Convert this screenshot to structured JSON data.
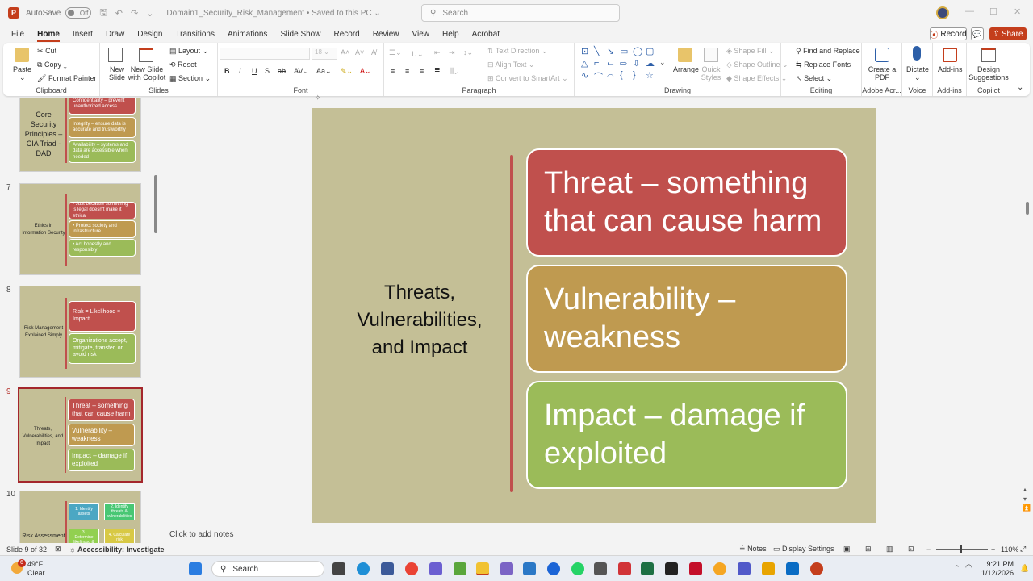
{
  "titlebar": {
    "autosave_label": "AutoSave",
    "autosave_state": "Off",
    "doc_title": "Domain1_Security_Risk_Management",
    "save_status": "Saved to this PC",
    "search_placeholder": "Search"
  },
  "menu": {
    "tabs": [
      "File",
      "Home",
      "Insert",
      "Draw",
      "Design",
      "Transitions",
      "Animations",
      "Slide Show",
      "Record",
      "Review",
      "View",
      "Help",
      "Acrobat"
    ],
    "record": "Record",
    "share": "Share"
  },
  "ribbon": {
    "clipboard": {
      "paste": "Paste",
      "cut": "Cut",
      "copy": "Copy",
      "format_painter": "Format Painter",
      "label": "Clipboard"
    },
    "slides": {
      "new_slide": "New Slide",
      "new_slide_copilot": "New Slide with Copilot",
      "layout": "Layout",
      "reset": "Reset",
      "section": "Section",
      "label": "Slides"
    },
    "font": {
      "label": "Font"
    },
    "paragraph": {
      "text_direction": "Text Direction",
      "align_text": "Align Text",
      "convert_smartart": "Convert to SmartArt",
      "label": "Paragraph"
    },
    "drawing": {
      "arrange": "Arrange",
      "quick_styles": "Quick Styles",
      "shape_fill": "Shape Fill",
      "shape_outline": "Shape Outline",
      "shape_effects": "Shape Effects",
      "label": "Drawing"
    },
    "editing": {
      "find_replace": "Find and Replace",
      "replace_fonts": "Replace Fonts",
      "select": "Select",
      "label": "Editing"
    },
    "acrobat": {
      "create_pdf": "Create a PDF",
      "label": "Adobe Acr..."
    },
    "voice": {
      "dictate": "Dictate",
      "label": "Voice"
    },
    "addins": {
      "addins": "Add-ins",
      "label": "Add-ins"
    },
    "copilot": {
      "design_suggestions": "Design Suggestions",
      "label": "Copilot"
    }
  },
  "thumbnails": [
    {
      "number": "",
      "title": "Core Security Principles – CIA Triad -DAD",
      "boxes": [
        "Confidentiality – prevent unauthorized access",
        "Integrity – ensure data is accurate and trustworthy",
        "Availability – systems and data are accessible when needed"
      ]
    },
    {
      "number": "7",
      "title": "Ethics in Information Security",
      "boxes": [
        "• Just because something is legal doesn't make it ethical",
        "• Protect society and infrastructure",
        "• Act honestly and responsibly"
      ]
    },
    {
      "number": "8",
      "title": "Risk Management Explained Simply",
      "boxes": [
        "Risk = Likelihood × Impact",
        "Organizations accept, mitigate, transfer, or avoid risk"
      ]
    },
    {
      "number": "9",
      "title": "Threats, Vulnerabilities, and Impact",
      "boxes": [
        "Threat – something that can cause harm",
        "Vulnerability – weakness",
        "Impact – damage if exploited"
      ]
    },
    {
      "number": "10",
      "title": "Risk Assessment",
      "boxes": [
        "1. Identify assets",
        "2. Identify threats & vulnerabilities",
        "3. Determine likelihood &",
        "4. Calculate risk"
      ]
    }
  ],
  "slide": {
    "title": "Threats, Vulnerabilities, and Impact",
    "boxes": [
      {
        "text": "Threat – something that can cause harm",
        "color": "#c0504d"
      },
      {
        "text": "Vulnerability – weakness",
        "color": "#bf9a50"
      },
      {
        "text": "Impact – damage if exploited",
        "color": "#9bbb59"
      }
    ],
    "background": "#c4bf96"
  },
  "notes_placeholder": "Click to add notes",
  "status": {
    "slide_of": "Slide 9 of 32",
    "accessibility": "Accessibility: Investigate",
    "notes": "Notes",
    "display_settings": "Display Settings",
    "zoom": "110%"
  },
  "taskbar": {
    "temp": "49°F",
    "condition": "Clear",
    "weather_badge": "6",
    "search": "Search",
    "time": "9:21 PM",
    "date": "1/12/2026"
  },
  "colors": {
    "accent": "#c43e1c",
    "active_slide": "#a4262c"
  }
}
